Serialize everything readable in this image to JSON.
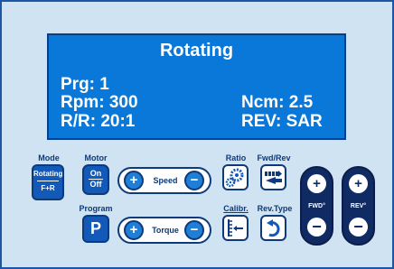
{
  "display": {
    "title": "Rotating",
    "line_prg": "Prg: 1",
    "line_rpm": "Rpm: 300",
    "line_ncm": "Ncm: 2.5",
    "line_rr": "R/R: 20:1",
    "line_rev": "REV: SAR"
  },
  "controls": {
    "mode": {
      "label": "Mode",
      "top": "Rotating",
      "bottom": "F+R"
    },
    "motor": {
      "label": "Motor",
      "top": "On",
      "bottom": "Off"
    },
    "program": {
      "label": "Program",
      "key": "P"
    },
    "speed": {
      "label": "Speed",
      "plus": "+",
      "minus": "−"
    },
    "torque": {
      "label": "Torque",
      "plus": "+",
      "minus": "−"
    },
    "ratio": {
      "label": "Ratio"
    },
    "fwdrev": {
      "label": "Fwd/Rev"
    },
    "calibr": {
      "label": "Calibr."
    },
    "revtype": {
      "label": "Rev.Type"
    },
    "fwd": {
      "label": "FWD°",
      "plus": "+",
      "minus": "−"
    },
    "rev": {
      "label": "REV°",
      "plus": "+",
      "minus": "−"
    }
  },
  "colors": {
    "panel": "#cfe3f3",
    "lcd": "#0a78d9",
    "dark_blue": "#102a63",
    "accent": "#1359b8"
  }
}
